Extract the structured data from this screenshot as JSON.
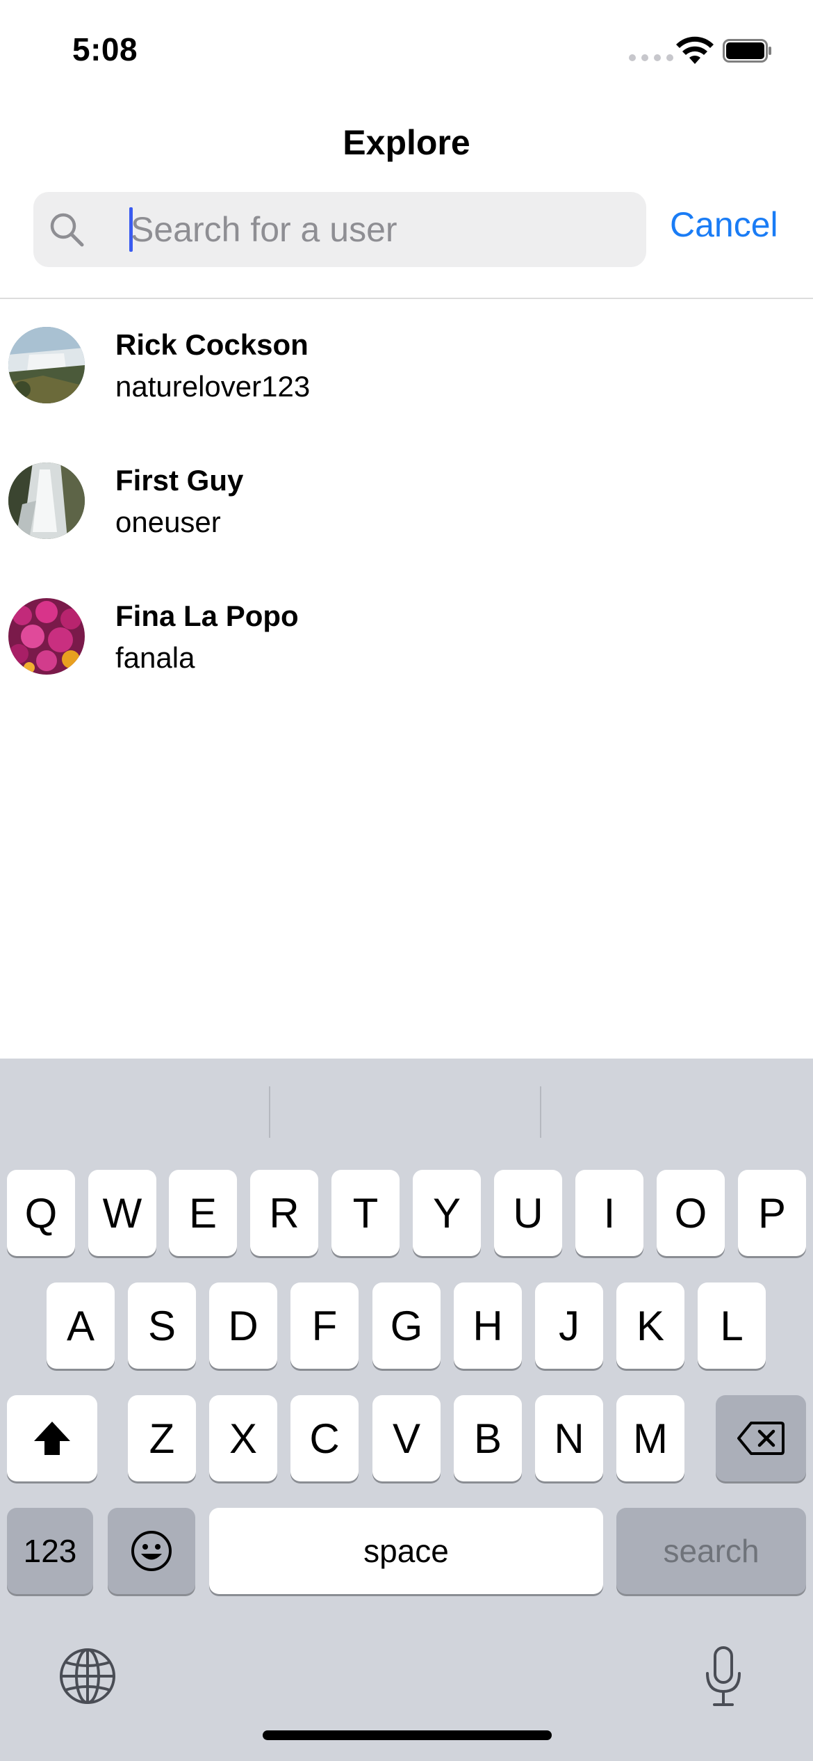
{
  "status_bar": {
    "time": "5:08"
  },
  "nav": {
    "title": "Explore"
  },
  "search": {
    "placeholder": "Search for a user",
    "value": "",
    "cancel_label": "Cancel"
  },
  "users": [
    {
      "name": "Rick Cockson",
      "handle": "naturelover123",
      "avatar": "waterfall-photo"
    },
    {
      "name": "First Guy",
      "handle": "oneuser",
      "avatar": "cascade-photo"
    },
    {
      "name": "Fina La Popo",
      "handle": "fanala",
      "avatar": "flowers-photo"
    }
  ],
  "keyboard": {
    "row1": [
      "Q",
      "W",
      "E",
      "R",
      "T",
      "Y",
      "U",
      "I",
      "O",
      "P"
    ],
    "row2": [
      "A",
      "S",
      "D",
      "F",
      "G",
      "H",
      "J",
      "K",
      "L"
    ],
    "row3": [
      "Z",
      "X",
      "C",
      "V",
      "B",
      "N",
      "M"
    ],
    "numbers_label": "123",
    "space_label": "space",
    "return_label": "search",
    "icons": [
      "shift-icon",
      "delete-icon",
      "emoji-icon",
      "globe-icon",
      "microphone-icon"
    ]
  },
  "colors": {
    "accent": "#1a7cf5",
    "cursor": "#3a5bf0",
    "keyboard_bg": "#d1d4db"
  }
}
